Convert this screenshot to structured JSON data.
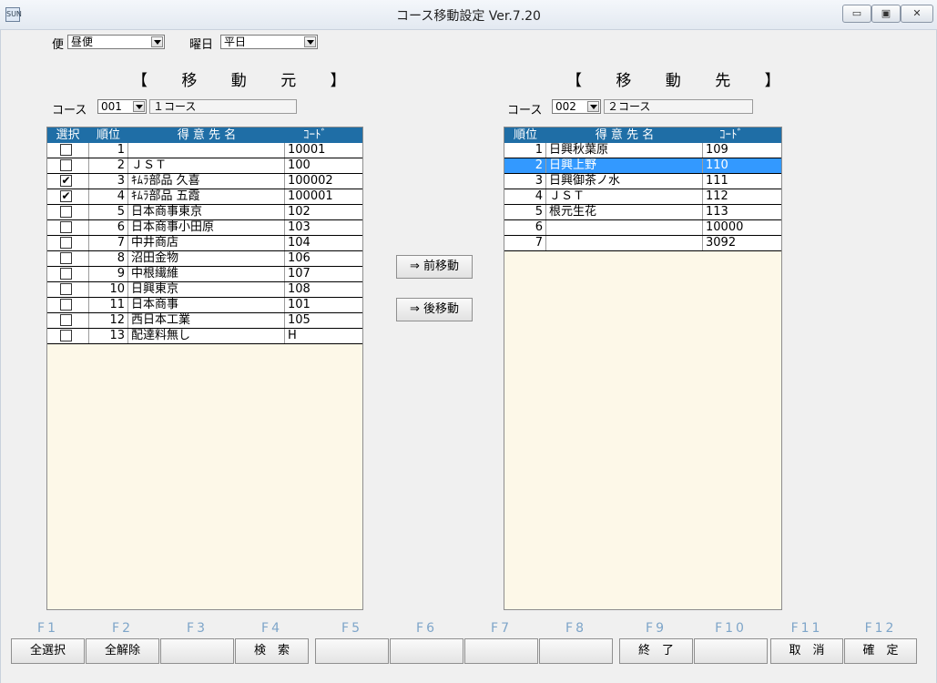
{
  "window": {
    "title": "コース移動設定 Ver.7.20",
    "icon_label": "SUN"
  },
  "filters": {
    "bin_label": "便",
    "bin_value": "昼便",
    "day_label": "曜日",
    "day_value": "平日"
  },
  "source": {
    "title": "【 移 動 元 】",
    "course_label": "コース",
    "course_code": "001",
    "course_name": "１コース",
    "columns": [
      "選択",
      "順位",
      "得 意 先 名",
      "ｺｰﾄﾞ"
    ],
    "rows": [
      {
        "checked": false,
        "rank": "1",
        "name": "",
        "code": "10001"
      },
      {
        "checked": false,
        "rank": "2",
        "name": "ＪＳＴ",
        "code": "100"
      },
      {
        "checked": true,
        "rank": "3",
        "name": "ｷﾑﾗ部品 久喜",
        "code": "100002"
      },
      {
        "checked": true,
        "rank": "4",
        "name": "ｷﾑﾗ部品 五霞",
        "code": "100001"
      },
      {
        "checked": false,
        "rank": "5",
        "name": "日本商事東京",
        "code": "102"
      },
      {
        "checked": false,
        "rank": "6",
        "name": "日本商事小田原",
        "code": "103"
      },
      {
        "checked": false,
        "rank": "7",
        "name": "中井商店",
        "code": "104"
      },
      {
        "checked": false,
        "rank": "8",
        "name": "沼田金物",
        "code": "106"
      },
      {
        "checked": false,
        "rank": "9",
        "name": "中根繊維",
        "code": "107"
      },
      {
        "checked": false,
        "rank": "10",
        "name": "日興東京",
        "code": "108"
      },
      {
        "checked": false,
        "rank": "11",
        "name": "日本商事",
        "code": "101"
      },
      {
        "checked": false,
        "rank": "12",
        "name": "西日本工業",
        "code": "105"
      },
      {
        "checked": false,
        "rank": "13",
        "name": "配達料無し",
        "code": "H"
      }
    ]
  },
  "dest": {
    "title": "【 移 動 先 】",
    "course_label": "コース",
    "course_code": "002",
    "course_name": "２コース",
    "columns": [
      "順位",
      "得 意 先 名",
      "ｺｰﾄﾞ"
    ],
    "rows": [
      {
        "rank": "1",
        "name": "日興秋葉原",
        "code": "109",
        "selected": false
      },
      {
        "rank": "2",
        "name": "日興上野",
        "code": "110",
        "selected": true
      },
      {
        "rank": "3",
        "name": "日興御茶ノ水",
        "code": "111",
        "selected": false
      },
      {
        "rank": "4",
        "name": "ＪＳＴ",
        "code": "112",
        "selected": false
      },
      {
        "rank": "5",
        "name": "根元生花",
        "code": "113",
        "selected": false
      },
      {
        "rank": "6",
        "name": "",
        "code": "10000",
        "selected": false
      },
      {
        "rank": "7",
        "name": "",
        "code": "3092",
        "selected": false
      }
    ]
  },
  "actions": {
    "move_front": "⇒ 前移動",
    "move_back": "⇒ 後移動"
  },
  "fkeys": [
    {
      "key": "F1",
      "label": "全選択"
    },
    {
      "key": "F2",
      "label": "全解除"
    },
    {
      "key": "F3",
      "label": ""
    },
    {
      "key": "F4",
      "label": "検　索"
    },
    {
      "key": "F5",
      "label": ""
    },
    {
      "key": "F6",
      "label": ""
    },
    {
      "key": "F7",
      "label": ""
    },
    {
      "key": "F8",
      "label": ""
    },
    {
      "key": "F9",
      "label": "終　了"
    },
    {
      "key": "F10",
      "label": ""
    },
    {
      "key": "F11",
      "label": "取　消"
    },
    {
      "key": "F12",
      "label": "確　定"
    }
  ],
  "colors": {
    "header_bg": "#1f6ea6",
    "grid_bg": "#fdf8e8",
    "selected_row": "#3399ff",
    "fkey_label": "#7ea5c9"
  }
}
